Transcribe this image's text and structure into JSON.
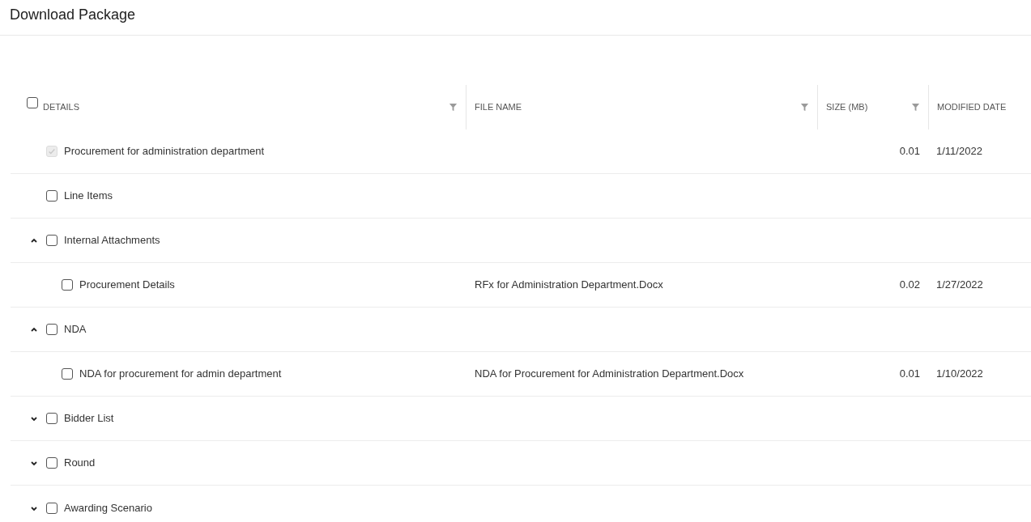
{
  "page": {
    "title": "Download Package"
  },
  "table": {
    "header_checkbox": {
      "checked": false
    },
    "columns": [
      {
        "label": "DETAILS",
        "filterable": true
      },
      {
        "label": "FILE NAME",
        "filterable": true
      },
      {
        "label": "SIZE (MB)",
        "filterable": true
      },
      {
        "label": "MODIFIED DATE",
        "filterable": false
      }
    ],
    "rows": [
      {
        "details": "Procurement for administration department",
        "file_name": "",
        "size": "0.01",
        "modified_date": "1/11/2022",
        "checked": true,
        "disabled": true
      },
      {
        "details": "Line Items",
        "checked": false,
        "disabled": false
      },
      {
        "details": "Internal Attachments",
        "checked": false,
        "disabled": false,
        "expanded": true,
        "children": [
          {
            "details": "Procurement Details",
            "file_name": "RFx for Administration Department.Docx",
            "size": "0.02",
            "modified_date": "1/27/2022",
            "checked": false,
            "disabled": false
          }
        ]
      },
      {
        "details": "NDA",
        "checked": false,
        "disabled": false,
        "expanded": true,
        "children": [
          {
            "details": "NDA for procurement for admin department",
            "file_name": "NDA for Procurement for Administration Department.Docx",
            "size": "0.01",
            "modified_date": "1/10/2022",
            "checked": false,
            "disabled": false
          }
        ]
      },
      {
        "details": "Bidder List",
        "checked": false,
        "disabled": false,
        "expanded": false
      },
      {
        "details": "Round",
        "checked": false,
        "disabled": false,
        "expanded": false
      },
      {
        "details": "Awarding Scenario",
        "checked": false,
        "disabled": false,
        "expanded": false
      }
    ]
  }
}
